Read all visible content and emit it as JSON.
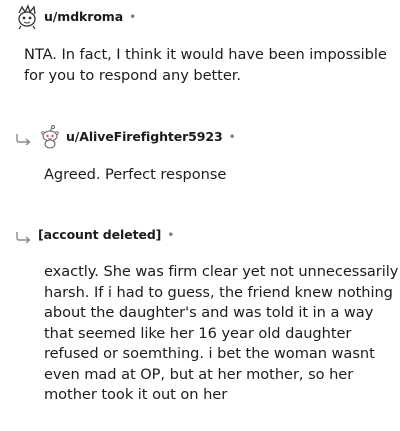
{
  "comments": [
    {
      "username": "u/mdkroma",
      "separator": "•",
      "avatar_icon": "snoo-avatar-icon",
      "lines": [
        "NTA. In fact, I think it would have been impossible",
        "for you to respond any better."
      ]
    },
    {
      "username": "u/AliveFirefighter5923",
      "separator": "•",
      "avatar_icon": "snoo-default-avatar-icon",
      "reply_icon": "reply-arrow-icon",
      "lines": [
        "Agreed. Perfect response"
      ]
    },
    {
      "username": "[account deleted]",
      "separator": "•",
      "reply_icon": "reply-arrow-icon",
      "lines": [
        "exactly. She was firm clear yet not unnecessarily",
        "harsh. If i had to guess, the friend knew nothing",
        "about the daughter's and was told it in a way",
        "that seemed like her 16 year old daughter",
        "refused or soemthing. i bet the woman wasnt",
        "even mad at OP, but at her mother, so her",
        "mother took it out on her"
      ]
    }
  ],
  "colors": {
    "text": "#1c1c1c",
    "muted": "#7c7c7c",
    "arrow": "#878a8c"
  }
}
